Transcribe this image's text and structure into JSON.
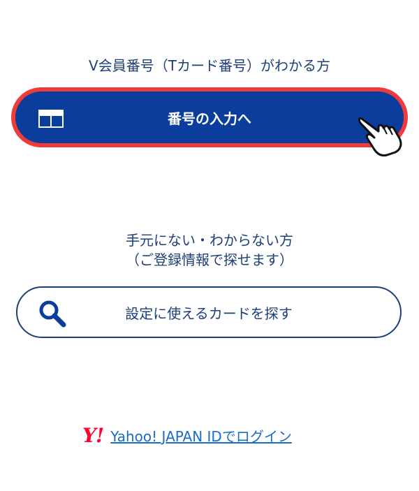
{
  "known_section": {
    "heading": "V会員番号（Tカード番号）がわかる方",
    "button_label": "番号の入力へ",
    "button_icon": "card-icon",
    "cursor_icon": "pointing-hand-icon"
  },
  "unknown_section": {
    "heading_line1": "手元にない・わからない方",
    "heading_line2": "（ご登録情報で探せます）",
    "button_label": "設定に使えるカードを探す",
    "button_icon": "search-icon"
  },
  "yahoo_login": {
    "logo_text": "Y!",
    "link_label": "Yahoo! JAPAN IDでログイン"
  },
  "colors": {
    "primary": "#0b3d9c",
    "highlight": "#ee3b3b",
    "text": "#1d3f78",
    "link": "#1a6cc8",
    "yahoo_red": "#ff0033"
  }
}
